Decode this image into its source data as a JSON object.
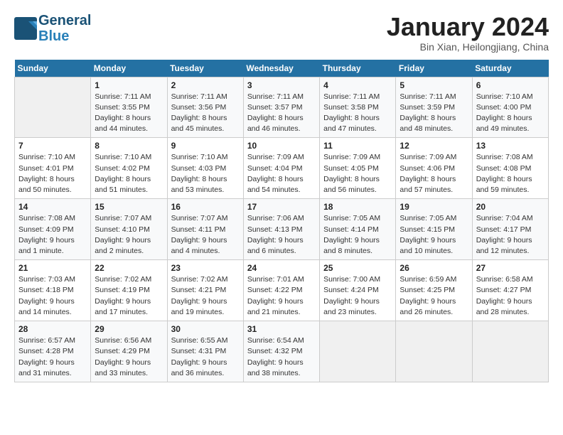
{
  "header": {
    "logo_line1": "General",
    "logo_line2": "Blue",
    "month": "January 2024",
    "location": "Bin Xian, Heilongjiang, China"
  },
  "weekdays": [
    "Sunday",
    "Monday",
    "Tuesday",
    "Wednesday",
    "Thursday",
    "Friday",
    "Saturday"
  ],
  "weeks": [
    [
      {
        "day": "",
        "info": ""
      },
      {
        "day": "1",
        "info": "Sunrise: 7:11 AM\nSunset: 3:55 PM\nDaylight: 8 hours\nand 44 minutes."
      },
      {
        "day": "2",
        "info": "Sunrise: 7:11 AM\nSunset: 3:56 PM\nDaylight: 8 hours\nand 45 minutes."
      },
      {
        "day": "3",
        "info": "Sunrise: 7:11 AM\nSunset: 3:57 PM\nDaylight: 8 hours\nand 46 minutes."
      },
      {
        "day": "4",
        "info": "Sunrise: 7:11 AM\nSunset: 3:58 PM\nDaylight: 8 hours\nand 47 minutes."
      },
      {
        "day": "5",
        "info": "Sunrise: 7:11 AM\nSunset: 3:59 PM\nDaylight: 8 hours\nand 48 minutes."
      },
      {
        "day": "6",
        "info": "Sunrise: 7:10 AM\nSunset: 4:00 PM\nDaylight: 8 hours\nand 49 minutes."
      }
    ],
    [
      {
        "day": "7",
        "info": "Sunrise: 7:10 AM\nSunset: 4:01 PM\nDaylight: 8 hours\nand 50 minutes."
      },
      {
        "day": "8",
        "info": "Sunrise: 7:10 AM\nSunset: 4:02 PM\nDaylight: 8 hours\nand 51 minutes."
      },
      {
        "day": "9",
        "info": "Sunrise: 7:10 AM\nSunset: 4:03 PM\nDaylight: 8 hours\nand 53 minutes."
      },
      {
        "day": "10",
        "info": "Sunrise: 7:09 AM\nSunset: 4:04 PM\nDaylight: 8 hours\nand 54 minutes."
      },
      {
        "day": "11",
        "info": "Sunrise: 7:09 AM\nSunset: 4:05 PM\nDaylight: 8 hours\nand 56 minutes."
      },
      {
        "day": "12",
        "info": "Sunrise: 7:09 AM\nSunset: 4:06 PM\nDaylight: 8 hours\nand 57 minutes."
      },
      {
        "day": "13",
        "info": "Sunrise: 7:08 AM\nSunset: 4:08 PM\nDaylight: 8 hours\nand 59 minutes."
      }
    ],
    [
      {
        "day": "14",
        "info": "Sunrise: 7:08 AM\nSunset: 4:09 PM\nDaylight: 9 hours\nand 1 minute."
      },
      {
        "day": "15",
        "info": "Sunrise: 7:07 AM\nSunset: 4:10 PM\nDaylight: 9 hours\nand 2 minutes."
      },
      {
        "day": "16",
        "info": "Sunrise: 7:07 AM\nSunset: 4:11 PM\nDaylight: 9 hours\nand 4 minutes."
      },
      {
        "day": "17",
        "info": "Sunrise: 7:06 AM\nSunset: 4:13 PM\nDaylight: 9 hours\nand 6 minutes."
      },
      {
        "day": "18",
        "info": "Sunrise: 7:05 AM\nSunset: 4:14 PM\nDaylight: 9 hours\nand 8 minutes."
      },
      {
        "day": "19",
        "info": "Sunrise: 7:05 AM\nSunset: 4:15 PM\nDaylight: 9 hours\nand 10 minutes."
      },
      {
        "day": "20",
        "info": "Sunrise: 7:04 AM\nSunset: 4:17 PM\nDaylight: 9 hours\nand 12 minutes."
      }
    ],
    [
      {
        "day": "21",
        "info": "Sunrise: 7:03 AM\nSunset: 4:18 PM\nDaylight: 9 hours\nand 14 minutes."
      },
      {
        "day": "22",
        "info": "Sunrise: 7:02 AM\nSunset: 4:19 PM\nDaylight: 9 hours\nand 17 minutes."
      },
      {
        "day": "23",
        "info": "Sunrise: 7:02 AM\nSunset: 4:21 PM\nDaylight: 9 hours\nand 19 minutes."
      },
      {
        "day": "24",
        "info": "Sunrise: 7:01 AM\nSunset: 4:22 PM\nDaylight: 9 hours\nand 21 minutes."
      },
      {
        "day": "25",
        "info": "Sunrise: 7:00 AM\nSunset: 4:24 PM\nDaylight: 9 hours\nand 23 minutes."
      },
      {
        "day": "26",
        "info": "Sunrise: 6:59 AM\nSunset: 4:25 PM\nDaylight: 9 hours\nand 26 minutes."
      },
      {
        "day": "27",
        "info": "Sunrise: 6:58 AM\nSunset: 4:27 PM\nDaylight: 9 hours\nand 28 minutes."
      }
    ],
    [
      {
        "day": "28",
        "info": "Sunrise: 6:57 AM\nSunset: 4:28 PM\nDaylight: 9 hours\nand 31 minutes."
      },
      {
        "day": "29",
        "info": "Sunrise: 6:56 AM\nSunset: 4:29 PM\nDaylight: 9 hours\nand 33 minutes."
      },
      {
        "day": "30",
        "info": "Sunrise: 6:55 AM\nSunset: 4:31 PM\nDaylight: 9 hours\nand 36 minutes."
      },
      {
        "day": "31",
        "info": "Sunrise: 6:54 AM\nSunset: 4:32 PM\nDaylight: 9 hours\nand 38 minutes."
      },
      {
        "day": "",
        "info": ""
      },
      {
        "day": "",
        "info": ""
      },
      {
        "day": "",
        "info": ""
      }
    ]
  ]
}
